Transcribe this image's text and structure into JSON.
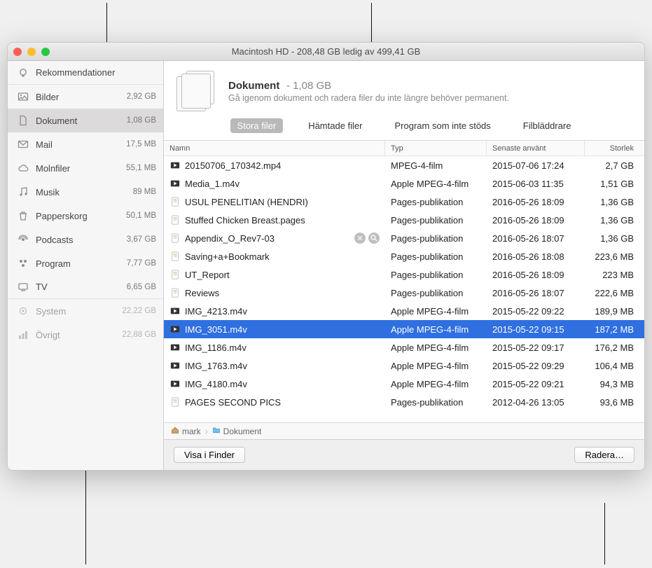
{
  "window": {
    "title": "Macintosh HD - 208,48 GB ledig av 499,41 GB"
  },
  "sidebar": {
    "items": [
      {
        "icon": "bulb",
        "label": "Rekommendationer",
        "size": "",
        "dim": false,
        "sep": true
      },
      {
        "icon": "photo",
        "label": "Bilder",
        "size": "2,92 GB",
        "dim": false
      },
      {
        "icon": "doc",
        "label": "Dokument",
        "size": "1,08 GB",
        "dim": false,
        "selected": true
      },
      {
        "icon": "mail",
        "label": "Mail",
        "size": "17,5 MB",
        "dim": false
      },
      {
        "icon": "cloud",
        "label": "Molnfiler",
        "size": "55,1 MB",
        "dim": false
      },
      {
        "icon": "music",
        "label": "Musik",
        "size": "89 MB",
        "dim": false
      },
      {
        "icon": "trash",
        "label": "Papperskorg",
        "size": "50,1 MB",
        "dim": false
      },
      {
        "icon": "podcast",
        "label": "Podcasts",
        "size": "3,67 GB",
        "dim": false
      },
      {
        "icon": "app",
        "label": "Program",
        "size": "7,77 GB",
        "dim": false
      },
      {
        "icon": "tv",
        "label": "TV",
        "size": "6,65 GB",
        "dim": false,
        "sep": true
      },
      {
        "icon": "gear",
        "label": "System",
        "size": "22,22 GB",
        "dim": true
      },
      {
        "icon": "bars",
        "label": "Övrigt",
        "size": "22,88 GB",
        "dim": true
      }
    ]
  },
  "header": {
    "title": "Dokument",
    "size": "- 1,08 GB",
    "subtitle": "Gå igenom dokument och radera filer du inte längre behöver permanent."
  },
  "tabs": [
    {
      "label": "Stora filer",
      "active": true
    },
    {
      "label": "Hämtade filer",
      "active": false
    },
    {
      "label": "Program som inte stöds",
      "active": false
    },
    {
      "label": "Filbläddrare",
      "active": false
    }
  ],
  "table": {
    "columns": [
      "Namn",
      "Typ",
      "Senaste använt",
      "Storlek"
    ],
    "rows": [
      {
        "icon": "video",
        "name": "20150706_170342.mp4",
        "type": "MPEG-4-film",
        "date": "2015-07-06 17:24",
        "size": "2,7 GB"
      },
      {
        "icon": "video",
        "name": "Media_1.m4v",
        "type": "Apple MPEG-4-film",
        "date": "2015-06-03 11:35",
        "size": "1,51 GB"
      },
      {
        "icon": "pages",
        "name": "USUL PENELITIAN (HENDRI)",
        "type": "Pages-publikation",
        "date": "2016-05-26 18:09",
        "size": "1,36 GB"
      },
      {
        "icon": "pages",
        "name": "Stuffed Chicken Breast.pages",
        "type": "Pages-publikation",
        "date": "2016-05-26 18:09",
        "size": "1,36 GB"
      },
      {
        "icon": "pages",
        "name": "Appendix_O_Rev7-03",
        "type": "Pages-publikation",
        "date": "2016-05-26 18:07",
        "size": "1,36 GB",
        "actions": true
      },
      {
        "icon": "pages",
        "name": "Saving+a+Bookmark",
        "type": "Pages-publikation",
        "date": "2016-05-26 18:08",
        "size": "223,6 MB"
      },
      {
        "icon": "pages",
        "name": "UT_Report",
        "type": "Pages-publikation",
        "date": "2016-05-26 18:09",
        "size": "223 MB"
      },
      {
        "icon": "pages",
        "name": "Reviews",
        "type": "Pages-publikation",
        "date": "2016-05-26 18:07",
        "size": "222,6 MB"
      },
      {
        "icon": "video",
        "name": "IMG_4213.m4v",
        "type": "Apple MPEG-4-film",
        "date": "2015-05-22 09:22",
        "size": "189,9 MB"
      },
      {
        "icon": "video",
        "name": "IMG_3051.m4v",
        "type": "Apple MPEG-4-film",
        "date": "2015-05-22 09:15",
        "size": "187,2 MB",
        "selected": true
      },
      {
        "icon": "video",
        "name": "IMG_1186.m4v",
        "type": "Apple MPEG-4-film",
        "date": "2015-05-22 09:17",
        "size": "176,2 MB"
      },
      {
        "icon": "video",
        "name": "IMG_1763.m4v",
        "type": "Apple MPEG-4-film",
        "date": "2015-05-22 09:29",
        "size": "106,4 MB"
      },
      {
        "icon": "video",
        "name": "IMG_4180.m4v",
        "type": "Apple MPEG-4-film",
        "date": "2015-05-22 09:21",
        "size": "94,3 MB"
      },
      {
        "icon": "pages",
        "name": "PAGES SECOND PICS",
        "type": "Pages-publikation",
        "date": "2012-04-26 13:05",
        "size": "93,6 MB"
      }
    ]
  },
  "pathbar": {
    "items": [
      {
        "icon": "home",
        "label": "mark"
      },
      {
        "icon": "folder",
        "label": "Dokument"
      }
    ]
  },
  "footer": {
    "show_in_finder": "Visa i Finder",
    "delete": "Radera…"
  }
}
